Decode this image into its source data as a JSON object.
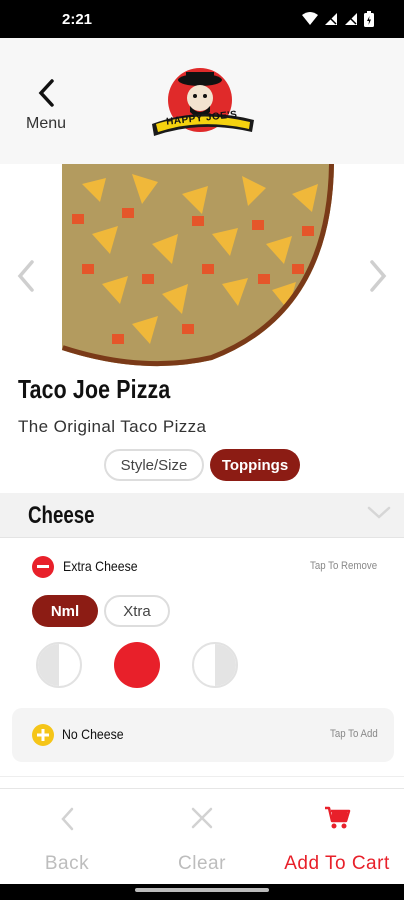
{
  "status_bar": {
    "time": "2:21"
  },
  "header": {
    "back_label": "Menu",
    "logo_text": "HAPPY JOE'S"
  },
  "product": {
    "name": "Taco Joe Pizza",
    "description": "The Original Taco Pizza"
  },
  "tabs": [
    {
      "label": "Style/Size",
      "active": false
    },
    {
      "label": "Toppings",
      "active": true
    }
  ],
  "section": {
    "title": "Cheese"
  },
  "toppings": [
    {
      "name": "Extra Cheese",
      "action": "Tap To Remove",
      "selected": true
    },
    {
      "name": "No Cheese",
      "action": "Tap To Add",
      "selected": false
    }
  ],
  "amount_options": [
    {
      "label": "Nml",
      "selected": true
    },
    {
      "label": "Xtra",
      "selected": false
    }
  ],
  "portion_options": [
    "left-half",
    "whole",
    "right-half"
  ],
  "portion_selected": "whole",
  "bottom_bar": {
    "back_label": "Back",
    "clear_label": "Clear",
    "cart_label": "Add To Cart"
  },
  "colors": {
    "brand_dark_red": "#8c1c14",
    "accent_red": "#e8202a",
    "add_yellow": "#f5c518",
    "disabled_gray": "#bdbdbd"
  }
}
